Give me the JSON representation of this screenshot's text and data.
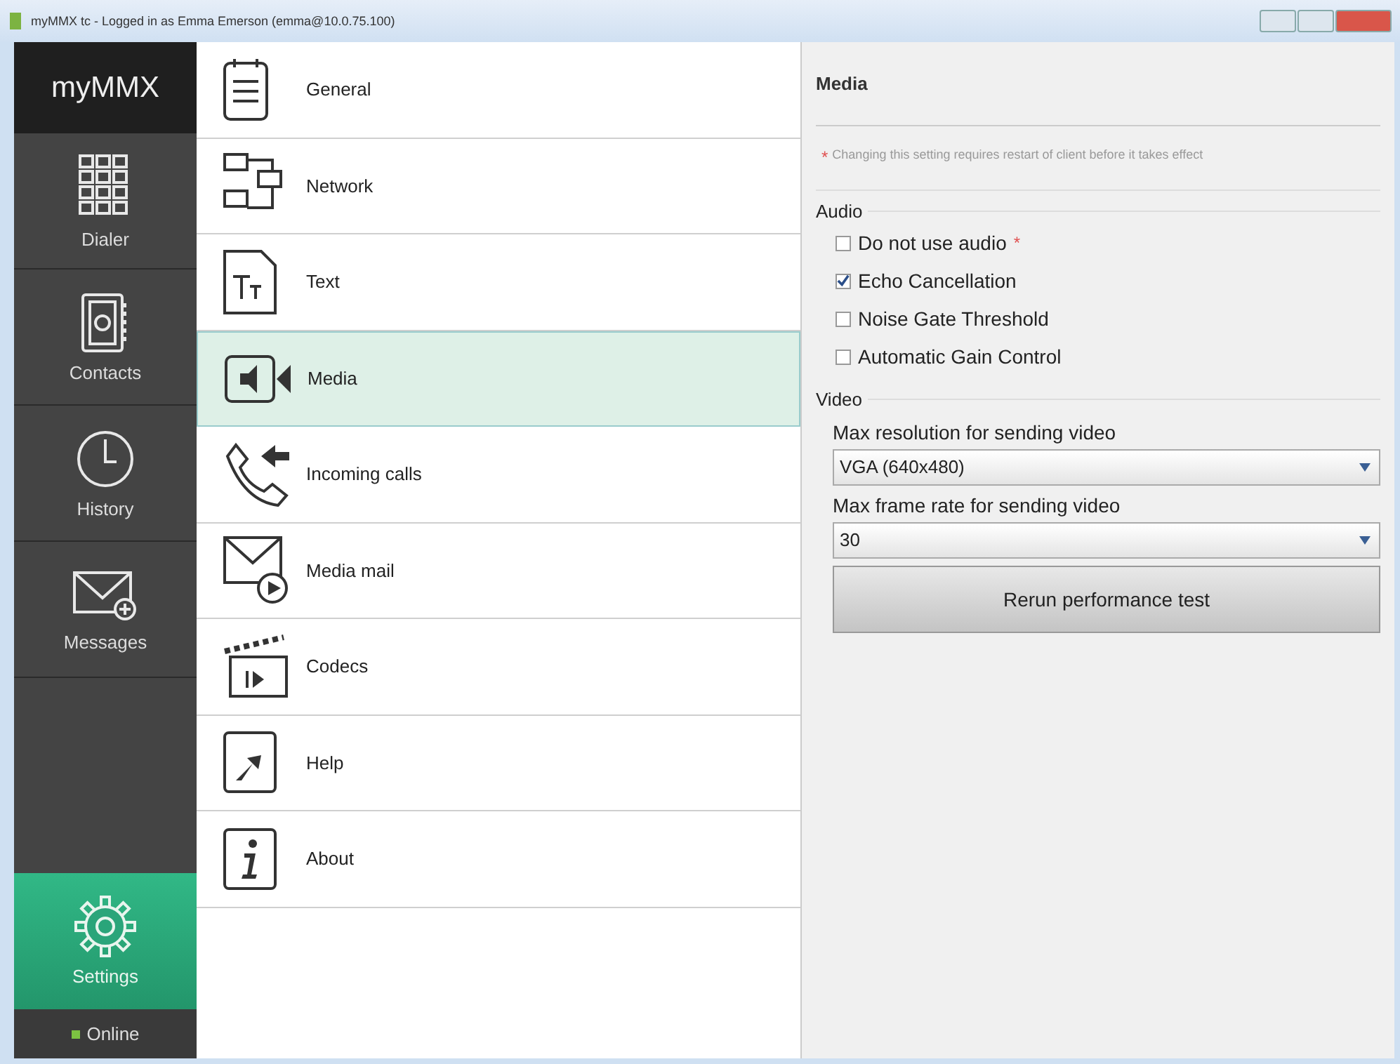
{
  "window": {
    "title": "myMMX tc - Logged in as Emma Emerson (emma@10.0.75.100)"
  },
  "sidebar": {
    "logo": "myMMX",
    "items": [
      {
        "label": "Dialer",
        "kind": "keypad",
        "selected": false
      },
      {
        "label": "Contacts",
        "kind": "book",
        "selected": false
      },
      {
        "label": "History",
        "kind": "clock",
        "selected": false
      },
      {
        "label": "Messages",
        "kind": "envelope",
        "selected": false
      },
      {
        "label": "Settings",
        "kind": "gear",
        "selected": true
      }
    ],
    "status": {
      "label": "Online",
      "color": "#7cc242"
    }
  },
  "menu": [
    {
      "label": "General",
      "kind": "list",
      "selected": false
    },
    {
      "label": "Network",
      "kind": "network",
      "selected": false
    },
    {
      "label": "Text",
      "kind": "text",
      "selected": false
    },
    {
      "label": "Media",
      "kind": "speaker",
      "selected": true
    },
    {
      "label": "Incoming calls",
      "kind": "phone",
      "selected": false
    },
    {
      "label": "Media mail",
      "kind": "mail",
      "selected": false
    },
    {
      "label": "Codecs",
      "kind": "clapper",
      "selected": false
    },
    {
      "label": "Help",
      "kind": "arrow",
      "selected": false
    },
    {
      "label": "About",
      "kind": "info",
      "selected": false
    }
  ],
  "panel": {
    "title": "Media",
    "notice": {
      "mark": "*",
      "text": "Changing this setting requires restart of client before it takes effect"
    },
    "audio": {
      "heading": "Audio",
      "options": [
        {
          "label": "Do not use audio",
          "required": "*",
          "checked": false
        },
        {
          "label": "Echo Cancellation",
          "checked": true
        },
        {
          "label": "Noise Gate Threshold",
          "checked": false
        },
        {
          "label": "Automatic Gain Control",
          "checked": false
        }
      ]
    },
    "video": {
      "heading": "Video",
      "fields": [
        {
          "label": "Max resolution for sending video",
          "value": "VGA (640x480)"
        },
        {
          "label": "Max frame rate for sending video",
          "value": "30"
        }
      ],
      "button": "Rerun performance test"
    }
  }
}
